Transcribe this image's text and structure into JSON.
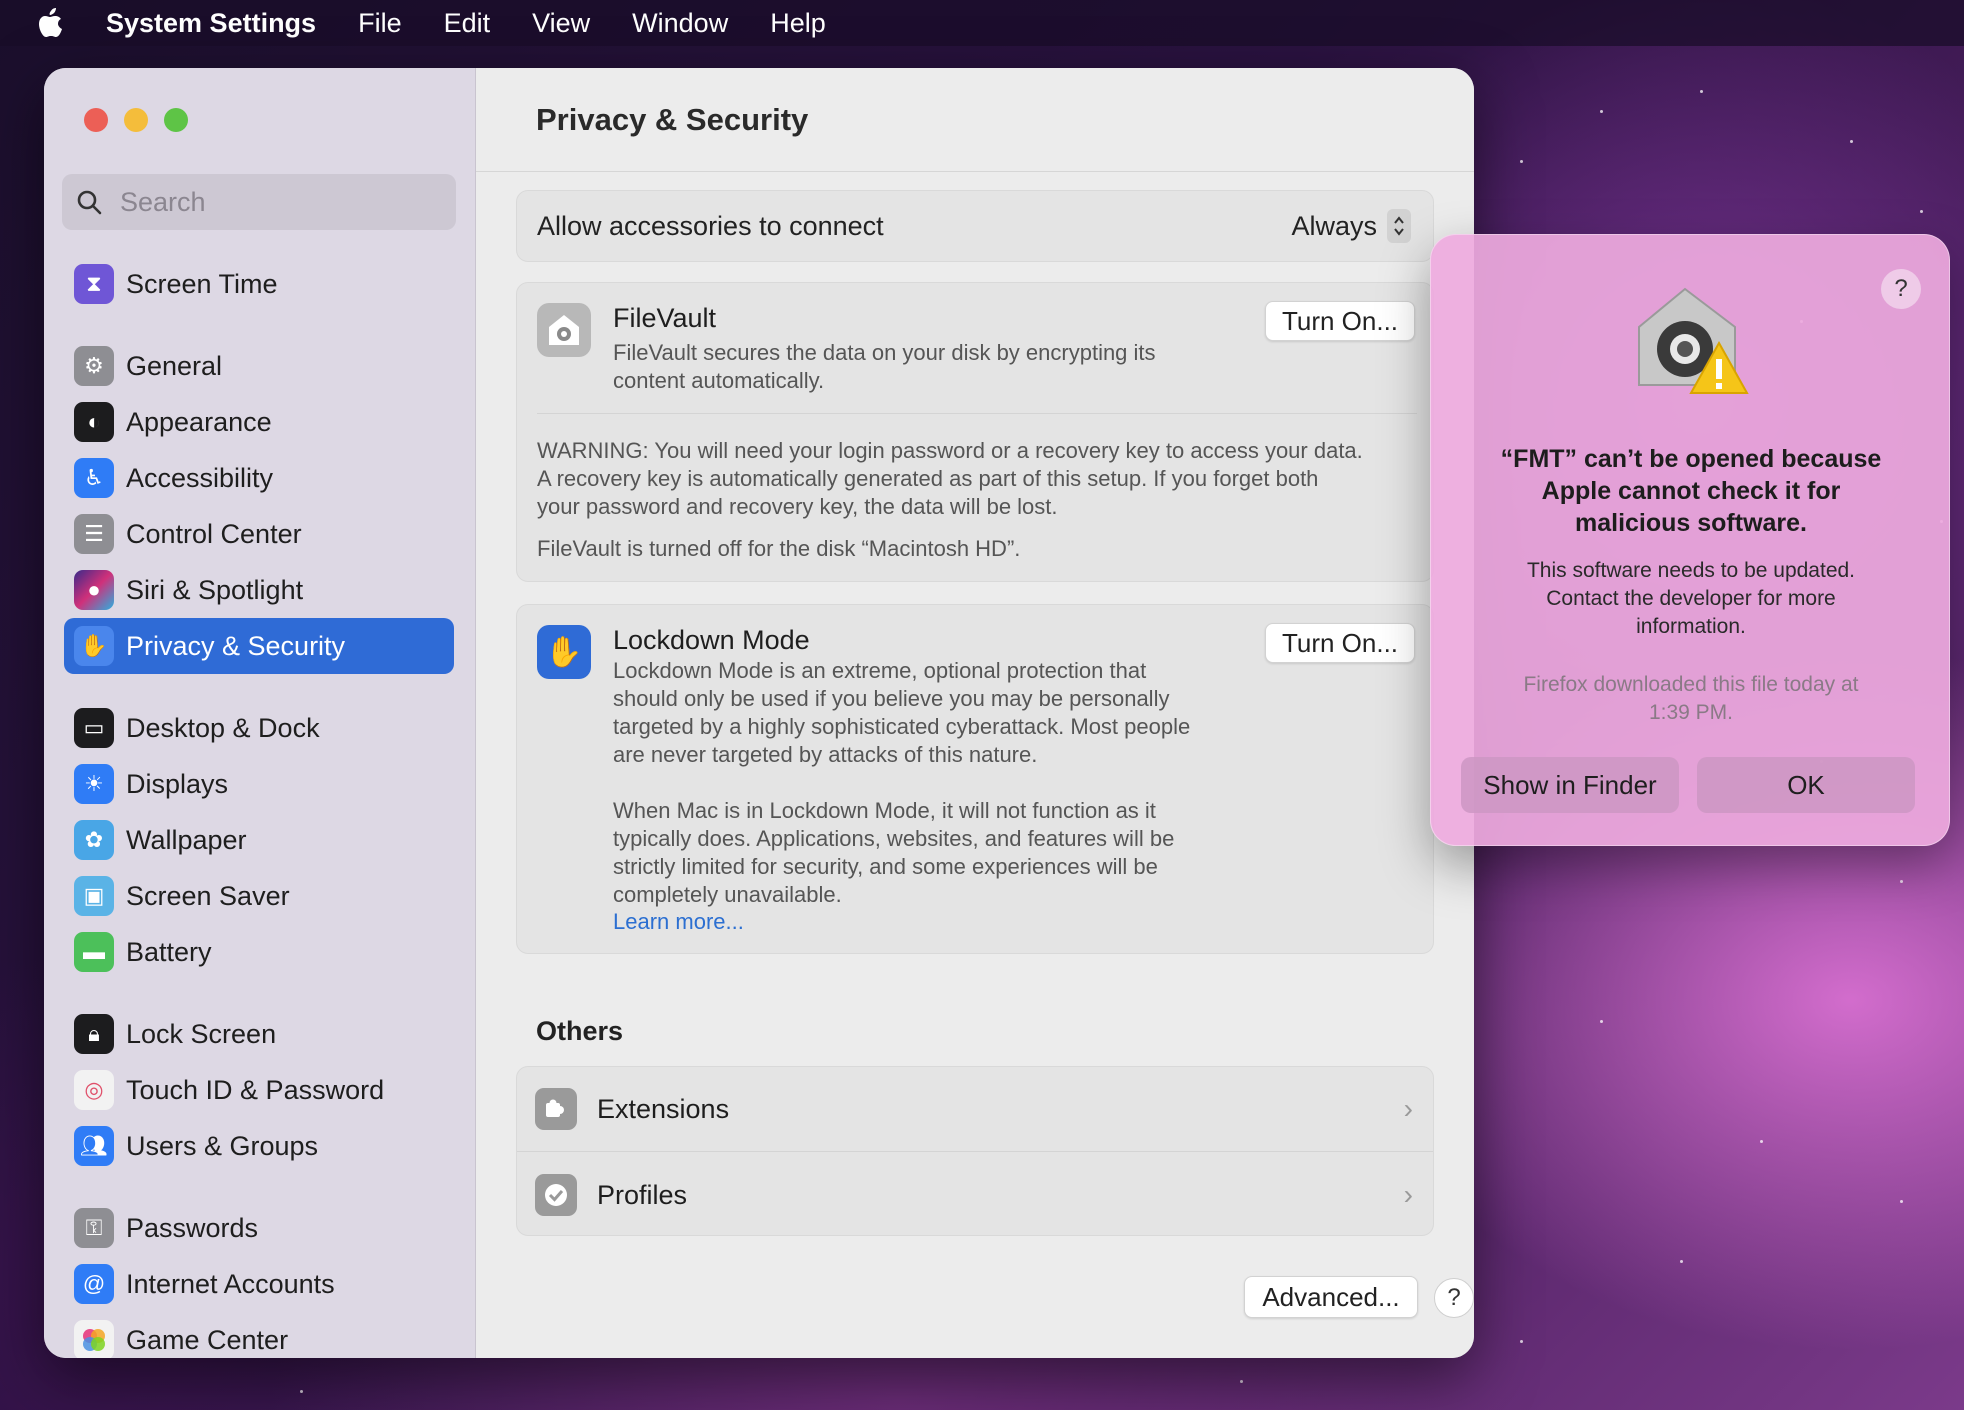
{
  "menubar": {
    "app_name": "System Settings",
    "items": [
      "File",
      "Edit",
      "View",
      "Window",
      "Help"
    ]
  },
  "sidebar": {
    "search_placeholder": "Search",
    "items": [
      {
        "label": "Screen Time",
        "icon": "hourglass-icon",
        "color": "#6f56d6"
      },
      {
        "label": "General",
        "icon": "gear-icon",
        "color": "#8e8e93"
      },
      {
        "label": "Appearance",
        "icon": "appearance-icon",
        "color": "#1c1c1e"
      },
      {
        "label": "Accessibility",
        "icon": "accessibility-icon",
        "color": "#2f7cf6"
      },
      {
        "label": "Control Center",
        "icon": "control-center-icon",
        "color": "#8e8e93"
      },
      {
        "label": "Siri & Spotlight",
        "icon": "siri-icon",
        "color": "#b03a9a"
      },
      {
        "label": "Privacy & Security",
        "icon": "hand-icon",
        "color": "#2f6bd6"
      },
      {
        "label": "Desktop & Dock",
        "icon": "dock-icon",
        "color": "#1c1c1e"
      },
      {
        "label": "Displays",
        "icon": "sun-icon",
        "color": "#2f7cf6"
      },
      {
        "label": "Wallpaper",
        "icon": "flower-icon",
        "color": "#49a6e6"
      },
      {
        "label": "Screen Saver",
        "icon": "screen-saver-icon",
        "color": "#5ab3e6"
      },
      {
        "label": "Battery",
        "icon": "battery-icon",
        "color": "#4cc05a"
      },
      {
        "label": "Lock Screen",
        "icon": "lock-icon",
        "color": "#1c1c1e"
      },
      {
        "label": "Touch ID & Password",
        "icon": "fingerprint-icon",
        "color": "#f2f2f2"
      },
      {
        "label": "Users & Groups",
        "icon": "users-icon",
        "color": "#2f7cf6"
      },
      {
        "label": "Passwords",
        "icon": "key-icon",
        "color": "#8e8e93"
      },
      {
        "label": "Internet Accounts",
        "icon": "at-icon",
        "color": "#2f7cf6"
      },
      {
        "label": "Game Center",
        "icon": "game-center-icon",
        "color": "#f2f2f2"
      }
    ]
  },
  "main": {
    "title": "Privacy & Security",
    "accessories": {
      "label": "Allow accessories to connect",
      "value": "Always"
    },
    "filevault": {
      "title": "FileVault",
      "button": "Turn On...",
      "desc_line1": "FileVault secures the data on your disk by encrypting its",
      "desc_line2": "content automatically.",
      "warning_line1": "WARNING: You will need your login password or a recovery key to access your data.",
      "warning_line2": "A recovery key is automatically generated as part of this setup. If you forget both",
      "warning_line3": "your password and recovery key, the data will be lost.",
      "status": "FileVault is turned off for the disk “Macintosh HD”."
    },
    "lockdown": {
      "title": "Lockdown Mode",
      "button": "Turn On...",
      "p1_l1": "Lockdown Mode is an extreme, optional protection that",
      "p1_l2": "should only be used if you believe you may be personally",
      "p1_l3": "targeted by a highly sophisticated cyberattack. Most people",
      "p1_l4": "are never targeted by attacks of this nature.",
      "p2_l1": "When Mac is in Lockdown Mode, it will not function as it",
      "p2_l2": "typically does. Applications, websites, and features will be",
      "p2_l3": "strictly limited for security, and some experiences will be",
      "p2_l4": "completely unavailable.",
      "link": "Learn more..."
    },
    "others_title": "Others",
    "others": [
      {
        "label": "Extensions",
        "icon": "puzzle-icon"
      },
      {
        "label": "Profiles",
        "icon": "checkmark-badge-icon"
      }
    ],
    "advanced_button": "Advanced...",
    "help": "?"
  },
  "dialog": {
    "help": "?",
    "title_l1": "“FMT” can’t be opened because",
    "title_l2": "Apple cannot check it for",
    "title_l3": "malicious software.",
    "msg_l1": "This software needs to be updated.",
    "msg_l2": "Contact the developer for more",
    "msg_l3": "information.",
    "note_l1": "Firefox downloaded this file today at",
    "note_l2": "1:39 PM.",
    "show_button": "Show in Finder",
    "ok_button": "OK"
  }
}
